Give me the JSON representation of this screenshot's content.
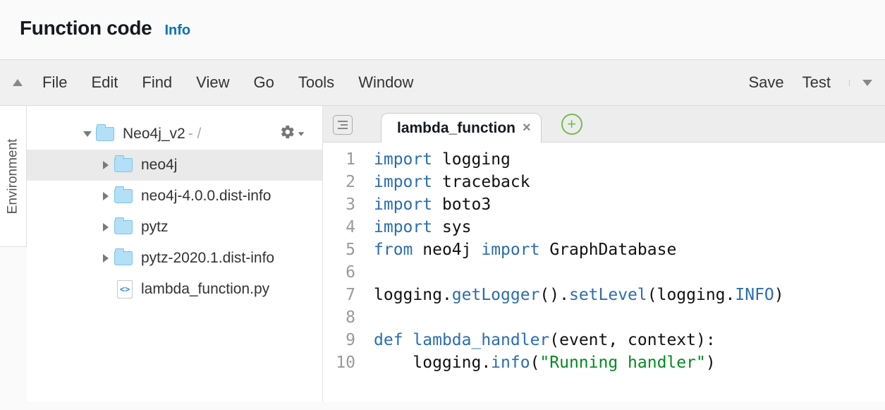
{
  "header": {
    "title": "Function code",
    "info_label": "Info"
  },
  "menubar": {
    "items": [
      "File",
      "Edit",
      "Find",
      "View",
      "Go",
      "Tools",
      "Window"
    ],
    "right": {
      "save": "Save",
      "test": "Test"
    }
  },
  "env_tab": "Environment",
  "tree": {
    "root": {
      "name": "Neo4j_v2",
      "suffix": "- /"
    },
    "children": [
      {
        "name": "neo4j",
        "type": "folder",
        "selected": true
      },
      {
        "name": "neo4j-4.0.0.dist-info",
        "type": "folder"
      },
      {
        "name": "pytz",
        "type": "folder"
      },
      {
        "name": "pytz-2020.1.dist-info",
        "type": "folder"
      },
      {
        "name": "lambda_function.py",
        "type": "file"
      }
    ]
  },
  "tab": {
    "name": "lambda_function"
  },
  "code": {
    "lines": [
      {
        "n": 1,
        "tokens": [
          [
            "kw",
            "import"
          ],
          [
            "sp",
            " "
          ],
          [
            "nm",
            "logging"
          ]
        ]
      },
      {
        "n": 2,
        "tokens": [
          [
            "kw",
            "import"
          ],
          [
            "sp",
            " "
          ],
          [
            "nm",
            "traceback"
          ]
        ]
      },
      {
        "n": 3,
        "tokens": [
          [
            "kw",
            "import"
          ],
          [
            "sp",
            " "
          ],
          [
            "nm",
            "boto3"
          ]
        ]
      },
      {
        "n": 4,
        "tokens": [
          [
            "kw",
            "import"
          ],
          [
            "sp",
            " "
          ],
          [
            "nm",
            "sys"
          ]
        ]
      },
      {
        "n": 5,
        "tokens": [
          [
            "kw",
            "from"
          ],
          [
            "sp",
            " "
          ],
          [
            "nm",
            "neo4j"
          ],
          [
            "sp",
            " "
          ],
          [
            "kw",
            "import"
          ],
          [
            "sp",
            " "
          ],
          [
            "nm",
            "GraphDatabase"
          ]
        ]
      },
      {
        "n": 6,
        "tokens": []
      },
      {
        "n": 7,
        "tokens": [
          [
            "nm",
            "logging"
          ],
          [
            "nm",
            "."
          ],
          [
            "fn",
            "getLogger"
          ],
          [
            "nm",
            "()."
          ],
          [
            "fn",
            "setLevel"
          ],
          [
            "nm",
            "(logging."
          ],
          [
            "const",
            "INFO"
          ],
          [
            "nm",
            ")"
          ]
        ]
      },
      {
        "n": 8,
        "tokens": []
      },
      {
        "n": 9,
        "tokens": [
          [
            "kw",
            "def"
          ],
          [
            "sp",
            " "
          ],
          [
            "fn",
            "lambda_handler"
          ],
          [
            "nm",
            "(event, context):"
          ]
        ]
      },
      {
        "n": 10,
        "tokens": [
          [
            "sp",
            "    "
          ],
          [
            "nm",
            "logging."
          ],
          [
            "fn",
            "info"
          ],
          [
            "nm",
            "("
          ],
          [
            "str",
            "\"Running handler\""
          ],
          [
            "nm",
            ")"
          ]
        ]
      }
    ]
  }
}
